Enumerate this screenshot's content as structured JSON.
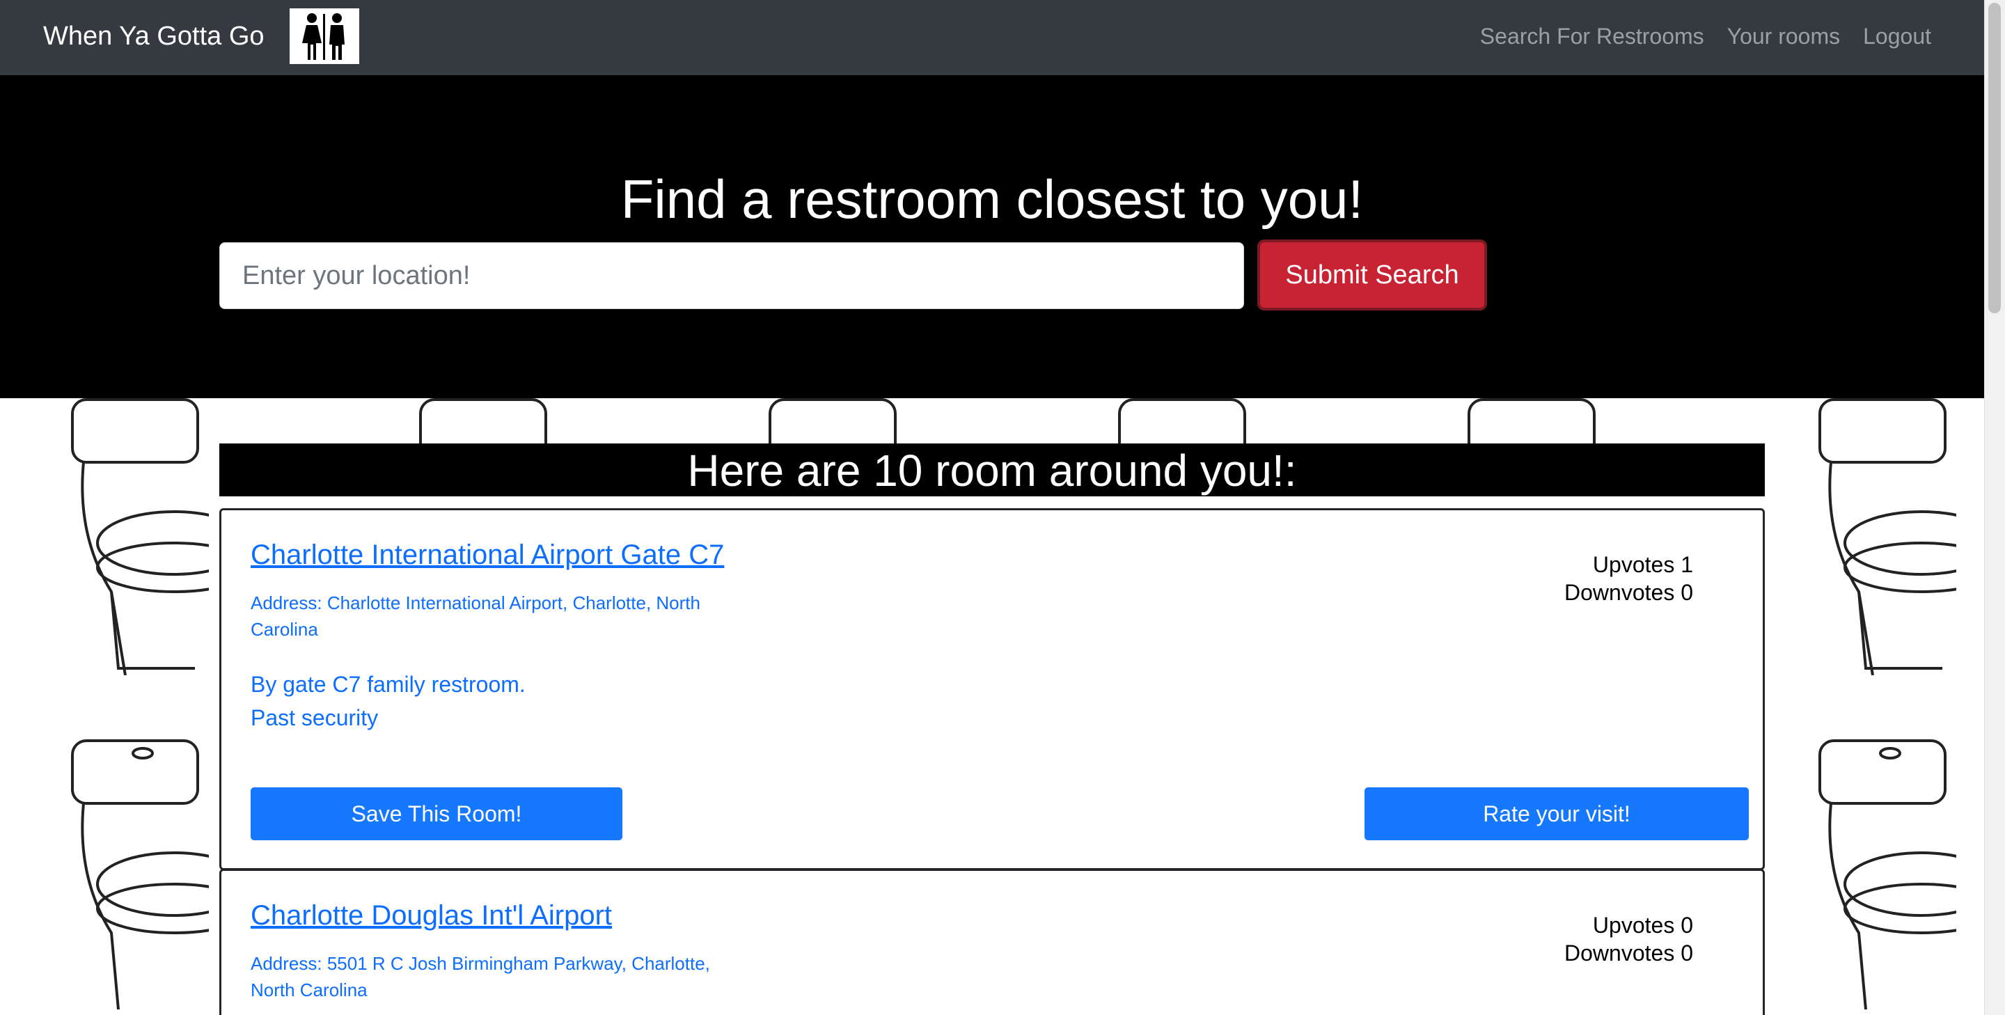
{
  "navbar": {
    "brand": "When Ya Gotta Go",
    "links": [
      {
        "label": "Search For Restrooms"
      },
      {
        "label": "Your rooms"
      },
      {
        "label": "Logout"
      }
    ]
  },
  "hero": {
    "title": "Find a restroom closest to you!",
    "search_placeholder": "Enter your location!",
    "search_value": "",
    "submit_label": "Submit Search"
  },
  "results": {
    "header": "Here are 10 room around you!:",
    "cards": [
      {
        "title": "Charlotte International Airport Gate C7",
        "address": "Address: Charlotte International Airport, Charlotte, North Carolina",
        "description_lines": [
          "By gate C7 family restroom.",
          "Past security"
        ],
        "upvotes": "Upvotes 1",
        "downvotes": "Downvotes 0",
        "save_label": "Save This Room!",
        "rate_label": "Rate your visit!"
      },
      {
        "title": "Charlotte Douglas Int'l Airport",
        "address": "Address: 5501 R C Josh Birmingham Parkway, Charlotte, North Carolina",
        "upvotes": "Upvotes 0",
        "downvotes": "Downvotes 0"
      }
    ]
  },
  "colors": {
    "navbar_bg": "#343a40",
    "hero_bg": "#000000",
    "submit_bg": "#c82333",
    "link_blue": "#0d6efd",
    "button_blue": "#1677ff"
  },
  "icons": {
    "brand_logo": "restroom-sign-icon",
    "background_pattern": "toilet-outline-icon"
  }
}
